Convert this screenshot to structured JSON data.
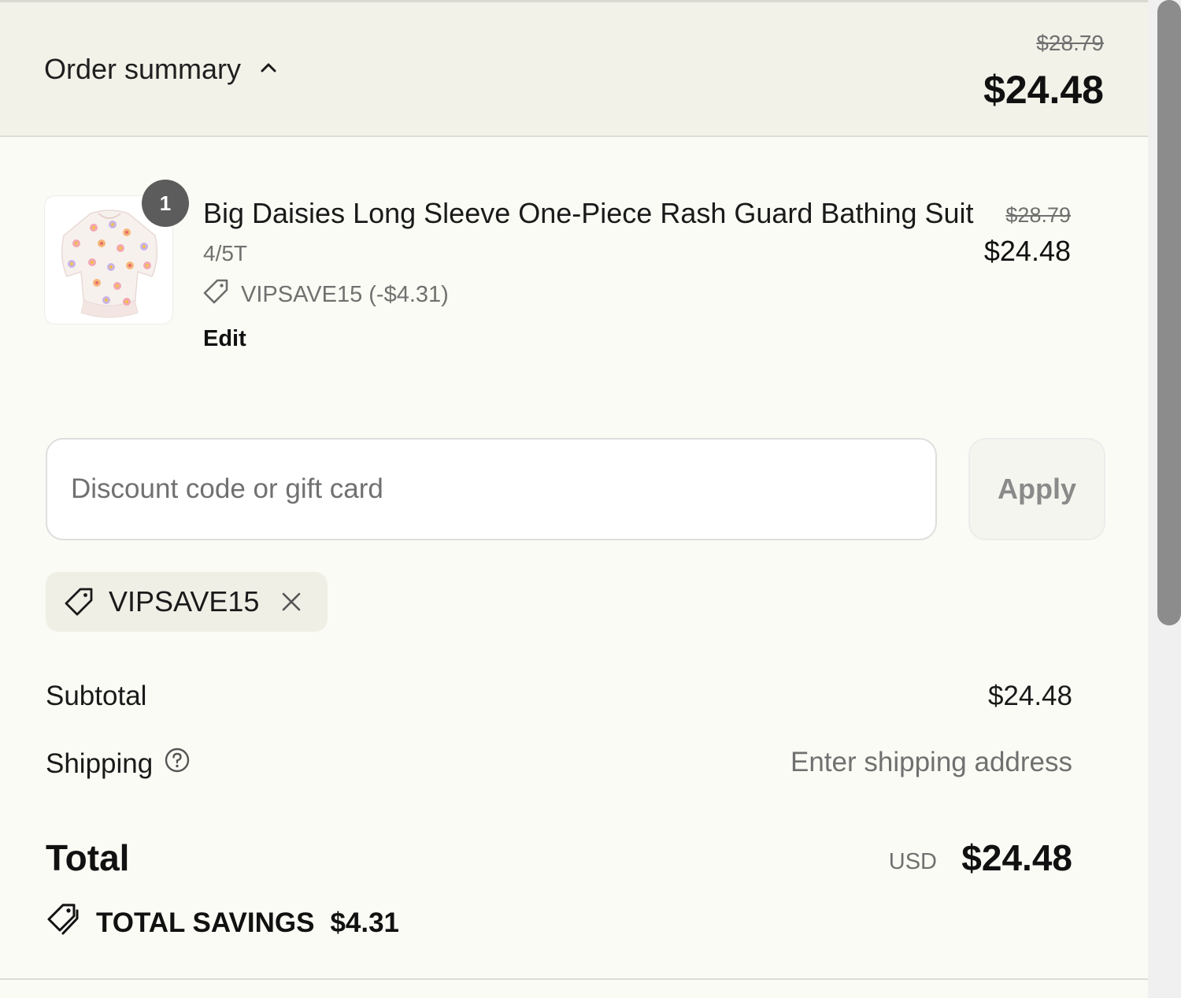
{
  "header": {
    "toggle_label": "Order summary",
    "compare_total": "$28.79",
    "total": "$24.48"
  },
  "line_item": {
    "quantity": "1",
    "title": "Big Daisies Long Sleeve One-Piece Rash Guard Bathing Suit",
    "variant": "4/5T",
    "discount": "VIPSAVE15 (-$4.31)",
    "edit_label": "Edit",
    "compare_price": "$28.79",
    "price": "$24.48"
  },
  "discount_form": {
    "placeholder": "Discount code or gift card",
    "value": "",
    "apply_label": "Apply"
  },
  "applied_code": {
    "code": "VIPSAVE15"
  },
  "totals": {
    "subtotal_label": "Subtotal",
    "subtotal_value": "$24.48",
    "shipping_label": "Shipping",
    "shipping_value": "Enter shipping address",
    "total_label": "Total",
    "currency": "USD",
    "total_value": "$24.48",
    "savings_label": "TOTAL SAVINGS",
    "savings_value": "$4.31"
  },
  "icons": {
    "toggle": "chevron-up-icon",
    "discount": "tag-icon",
    "remove": "close-icon",
    "help": "question-circle-icon",
    "savings": "tags-icon"
  }
}
